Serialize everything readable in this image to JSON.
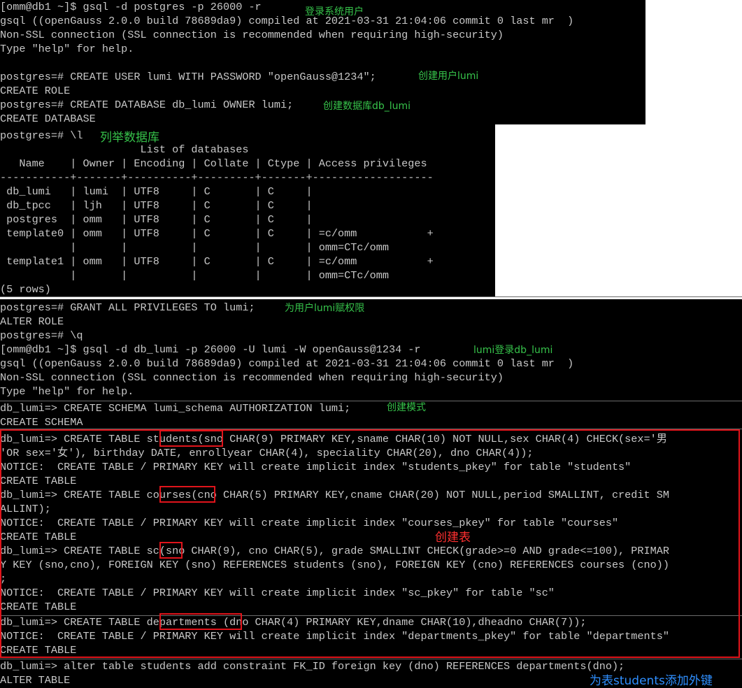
{
  "panel1": {
    "lines": [
      "[omm@db1 ~]$ gsql -d postgres -p 26000 -r",
      "gsql ((openGauss 2.0.0 build 78689da9) compiled at 2021-03-31 21:04:06 commit 0 last mr  )",
      "Non-SSL connection (SSL connection is recommended when requiring high-security)",
      "Type \"help\" for help.",
      "",
      "postgres=# CREATE USER lumi WITH PASSWORD \"openGauss@1234\";",
      "CREATE ROLE",
      "postgres=# CREATE DATABASE db_lumi OWNER lumi;",
      "CREATE DATABASE"
    ],
    "annotations": {
      "login": "登录系统用户",
      "create_user": "创建用户lumi",
      "create_db": "创建数据库db_lumi"
    }
  },
  "panel2": {
    "lines": [
      "postgres=# \\l",
      "                      List of databases",
      "   Name    | Owner | Encoding | Collate | Ctype | Access privileges",
      "-----------+-------+----------+---------+-------+-------------------",
      " db_lumi   | lumi  | UTF8     | C       | C     |",
      " db_tpcc   | ljh   | UTF8     | C       | C     |",
      " postgres  | omm   | UTF8     | C       | C     |",
      " template0 | omm   | UTF8     | C       | C     | =c/omm           +",
      "           |       |          |         |       | omm=CTc/omm",
      " template1 | omm   | UTF8     | C       | C     | =c/omm           +",
      "           |       |          |         |       | omm=CTc/omm",
      "(5 rows)"
    ],
    "annotations": {
      "list_db": "列举数据库"
    }
  },
  "panel3": {
    "lines": [
      "postgres=# GRANT ALL PRIVILEGES TO lumi;",
      "ALTER ROLE",
      "postgres=# \\q",
      "[omm@db1 ~]$ gsql -d db_lumi -p 26000 -U lumi -W openGauss@1234 -r",
      "gsql ((openGauss 2.0.0 build 78689da9) compiled at 2021-03-31 21:04:06 commit 0 last mr  )",
      "Non-SSL connection (SSL connection is recommended when requiring high-security)",
      "Type \"help\" for help."
    ],
    "annotations": {
      "grant": "为用户lumi赋权限",
      "login_db": "lumi登录db_lumi"
    }
  },
  "panel4": {
    "lines": [
      "db_lumi=> CREATE SCHEMA lumi_schema AUTHORIZATION lumi;",
      "CREATE SCHEMA"
    ],
    "annotations": {
      "create_schema": "创建模式"
    }
  },
  "panel5": {
    "lines": [
      "db_lumi=> CREATE TABLE students(sno CHAR(9) PRIMARY KEY,sname CHAR(10) NOT NULL,sex CHAR(4) CHECK(sex='男",
      "'OR sex='女'), birthday DATE, enrollyear CHAR(4), speciality CHAR(20), dno CHAR(4));",
      "NOTICE:  CREATE TABLE / PRIMARY KEY will create implicit index \"students_pkey\" for table \"students\"",
      "CREATE TABLE",
      "db_lumi=> CREATE TABLE courses(cno CHAR(5) PRIMARY KEY,cname CHAR(20) NOT NULL,period SMALLINT, credit SM",
      "ALLINT);",
      "NOTICE:  CREATE TABLE / PRIMARY KEY will create implicit index \"courses_pkey\" for table \"courses\"",
      "CREATE TABLE",
      "db_lumi=> CREATE TABLE sc(sno CHAR(9), cno CHAR(5), grade SMALLINT CHECK(grade>=0 AND grade<=100), PRIMAR",
      "Y KEY (sno,cno), FOREIGN KEY (sno) REFERENCES students (sno), FOREIGN KEY (cno) REFERENCES courses (cno))",
      ";",
      "NOTICE:  CREATE TABLE / PRIMARY KEY will create implicit index \"sc_pkey\" for table \"sc\"",
      "CREATE TABLE"
    ],
    "annotations": {
      "create_table": "创建表"
    }
  },
  "panel6": {
    "lines": [
      "db_lumi=> CREATE TABLE departments (dno CHAR(4) PRIMARY KEY,dname CHAR(10),dheadno CHAR(7));",
      "NOTICE:  CREATE TABLE / PRIMARY KEY will create implicit index \"departments_pkey\" for table \"departments\"",
      "CREATE TABLE"
    ]
  },
  "panel7": {
    "lines": [
      "db_lumi=> alter table students add constraint FK_ID foreign key (dno) REFERENCES departments(dno);",
      "ALTER TABLE"
    ],
    "annotations": {
      "add_fk": "为表students添加外键"
    }
  },
  "colors": {
    "terminal_bg": "#000000",
    "terminal_fg": "#c8c8c8",
    "annotation_green": "#36c24a",
    "annotation_red": "#ff3030",
    "annotation_blue": "#2f8fff",
    "highlight_box": "#e0141b"
  }
}
